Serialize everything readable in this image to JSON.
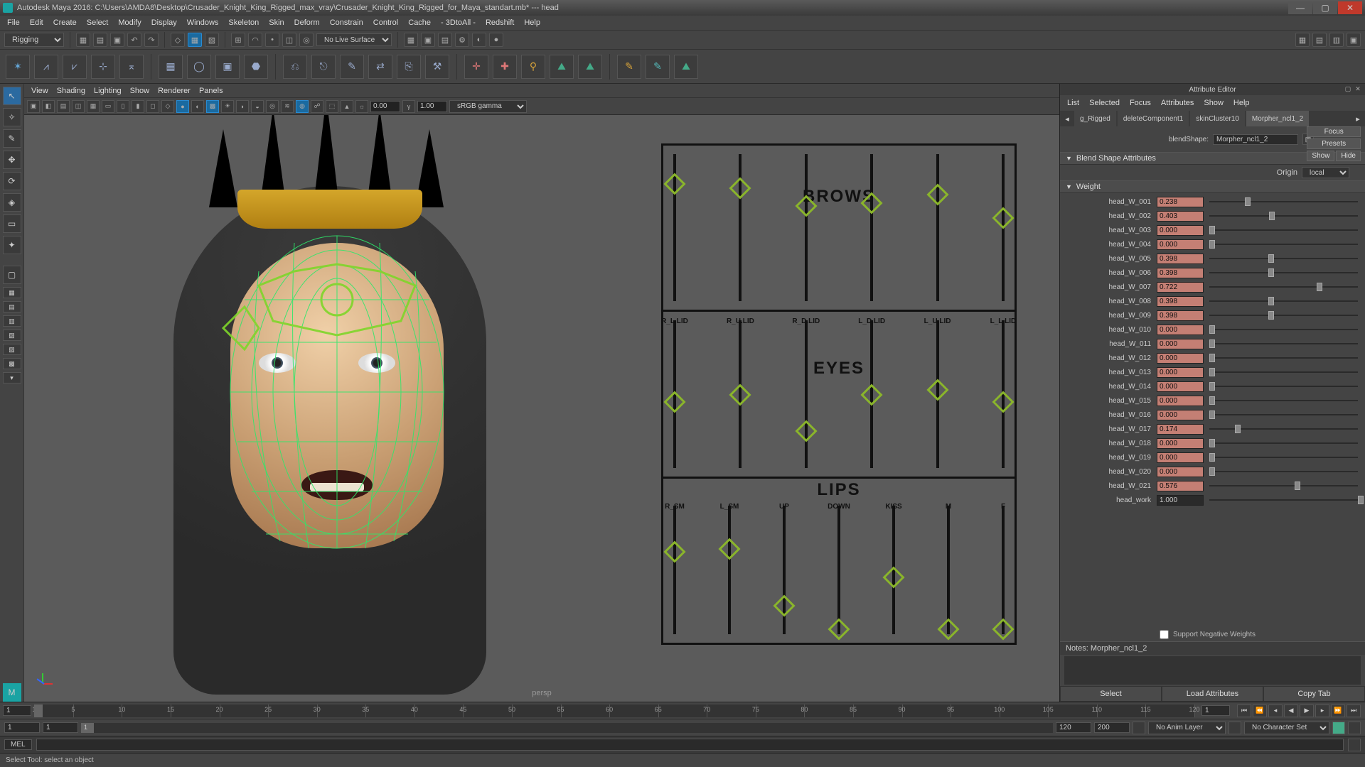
{
  "title": "Autodesk Maya 2016: C:\\Users\\AMDA8\\Desktop\\Crusader_Knight_King_Rigged_max_vray\\Crusader_Knight_King_Rigged_for_Maya_standart.mb*  ---  head",
  "mainMenu": [
    "File",
    "Edit",
    "Create",
    "Select",
    "Modify",
    "Display",
    "Windows",
    "Skeleton",
    "Skin",
    "Deform",
    "Constrain",
    "Control",
    "Cache",
    "- 3DtoAll -",
    "Redshift",
    "Help"
  ],
  "workspace": "Rigging",
  "liveSurface": "No Live Surface",
  "panelMenu": [
    "View",
    "Shading",
    "Lighting",
    "Show",
    "Renderer",
    "Panels"
  ],
  "exposure": "0.00",
  "gammaVal": "1.00",
  "gammaMode": "sRGB gamma",
  "perspLabel": "persp",
  "facePanel": {
    "brows": {
      "title": "BROWS",
      "sliders": [
        {
          "pos": 0.85
        },
        {
          "pos": 0.82
        },
        {
          "pos": 0.7
        },
        {
          "pos": 0.72
        },
        {
          "pos": 0.78
        },
        {
          "pos": 0.62
        }
      ]
    },
    "eyes": {
      "title": "EYES",
      "labels": [
        "R_L.LID",
        "R_U.LID",
        "R_D.LID",
        "L_D.LID",
        "L_U.LID",
        "L_L.LID"
      ],
      "sliders": [
        {
          "pos": 0.5,
          "lbl": "R_L.LID"
        },
        {
          "pos": 0.55,
          "lbl": "R_U.LID"
        },
        {
          "pos": 0.3,
          "lbl": "R_D.LID"
        },
        {
          "pos": 0.55,
          "lbl": "L_D.LID"
        },
        {
          "pos": 0.58,
          "lbl": "L_U.LID"
        },
        {
          "pos": 0.5,
          "lbl": "L_L.LID"
        }
      ]
    },
    "lips": {
      "title": "LIPS",
      "sliders": [
        {
          "pos": 0.7,
          "lbl": "R_SM"
        },
        {
          "pos": 0.72,
          "lbl": "L_SM"
        },
        {
          "pos": 0.28,
          "lbl": "UP"
        },
        {
          "pos": 0.1,
          "lbl": "DOWN"
        },
        {
          "pos": 0.5,
          "lbl": "KISS"
        },
        {
          "pos": 0.1,
          "lbl": "M"
        },
        {
          "pos": 0.1,
          "lbl": "F"
        }
      ]
    }
  },
  "attrEditor": {
    "title": "Attribute Editor",
    "menu": [
      "List",
      "Selected",
      "Focus",
      "Attributes",
      "Show",
      "Help"
    ],
    "tabs": [
      "g_Rigged",
      "deleteComponent1",
      "skinCluster10",
      "Morpher_ncl1_2"
    ],
    "activeTab": 3,
    "blendShapeLabel": "blendShape:",
    "blendShapeValue": "Morpher_ncl1_2",
    "btnFocus": "Focus",
    "btnPresets": "Presets",
    "btnShow": "Show",
    "btnHide": "Hide",
    "sectBlend": "Blend Shape Attributes",
    "originLabel": "Origin",
    "originValue": "local",
    "sectWeight": "Weight",
    "weights": [
      {
        "name": "head_W_001",
        "val": "0.238",
        "p": 0.238,
        "pink": true
      },
      {
        "name": "head_W_002",
        "val": "0.403",
        "p": 0.403,
        "pink": true
      },
      {
        "name": "head_W_003",
        "val": "0.000",
        "p": 0.0,
        "pink": true
      },
      {
        "name": "head_W_004",
        "val": "0.000",
        "p": 0.0,
        "pink": true
      },
      {
        "name": "head_W_005",
        "val": "0.398",
        "p": 0.398,
        "pink": true
      },
      {
        "name": "head_W_006",
        "val": "0.398",
        "p": 0.398,
        "pink": true
      },
      {
        "name": "head_W_007",
        "val": "0.722",
        "p": 0.722,
        "pink": true
      },
      {
        "name": "head_W_008",
        "val": "0.398",
        "p": 0.398,
        "pink": true
      },
      {
        "name": "head_W_009",
        "val": "0.398",
        "p": 0.398,
        "pink": true
      },
      {
        "name": "head_W_010",
        "val": "0.000",
        "p": 0.0,
        "pink": true
      },
      {
        "name": "head_W_011",
        "val": "0.000",
        "p": 0.0,
        "pink": true
      },
      {
        "name": "head_W_012",
        "val": "0.000",
        "p": 0.0,
        "pink": true
      },
      {
        "name": "head_W_013",
        "val": "0.000",
        "p": 0.0,
        "pink": true
      },
      {
        "name": "head_W_014",
        "val": "0.000",
        "p": 0.0,
        "pink": true
      },
      {
        "name": "head_W_015",
        "val": "0.000",
        "p": 0.0,
        "pink": true
      },
      {
        "name": "head_W_016",
        "val": "0.000",
        "p": 0.0,
        "pink": true
      },
      {
        "name": "head_W_017",
        "val": "0.174",
        "p": 0.174,
        "pink": true
      },
      {
        "name": "head_W_018",
        "val": "0.000",
        "p": 0.0,
        "pink": true
      },
      {
        "name": "head_W_019",
        "val": "0.000",
        "p": 0.0,
        "pink": true
      },
      {
        "name": "head_W_020",
        "val": "0.000",
        "p": 0.0,
        "pink": true
      },
      {
        "name": "head_W_021",
        "val": "0.576",
        "p": 0.576,
        "pink": true
      },
      {
        "name": "head_work",
        "val": "1.000",
        "p": 1.0,
        "pink": false
      }
    ],
    "negWeights": "Support Negative Weights",
    "notesTitle": "Notes:  Morpher_ncl1_2",
    "btnSelect": "Select",
    "btnLoad": "Load Attributes",
    "btnCopy": "Copy Tab"
  },
  "time": {
    "start": "1",
    "end": "120",
    "curFrame": "1",
    "ticks": [
      1,
      5,
      10,
      15,
      20,
      25,
      30,
      35,
      40,
      45,
      50,
      55,
      60,
      65,
      70,
      75,
      80,
      85,
      90,
      95,
      100,
      105,
      110,
      115,
      120
    ],
    "rangeStart": "1",
    "rangeStartInner": "1",
    "rangeEnd": "120",
    "rangeEndOuter": "200",
    "animLayer": "No Anim Layer",
    "charSet": "No Character Set"
  },
  "cmd": {
    "lang": "MEL",
    "value": ""
  },
  "help": "Select Tool: select an object"
}
